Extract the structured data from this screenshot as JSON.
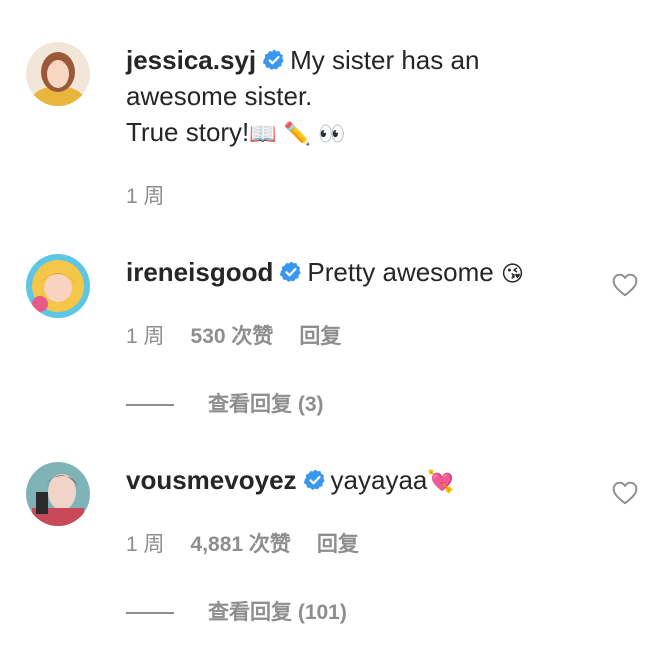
{
  "comments": [
    {
      "username": "jessica.syj",
      "verified": true,
      "text_line1": "My sister has an",
      "text_line2": "awesome sister.",
      "text_line3": "True story!",
      "emojis": "📖 ✏️ 👀",
      "time": "1 周"
    },
    {
      "username": "ireneisgood",
      "verified": true,
      "text": "Pretty awesome",
      "emoji": "😘",
      "time": "1 周",
      "likes": "530 次赞",
      "reply": "回复",
      "view_replies": "查看回复 (3)"
    },
    {
      "username": "vousmevoyez",
      "verified": true,
      "text": "yayayaa",
      "emoji": "💘",
      "time": "1 周",
      "likes": "4,881 次赞",
      "reply": "回复",
      "view_replies": "查看回复 (101)"
    }
  ],
  "colors": {
    "primary_text": "#262626",
    "secondary_text": "#8e8e8e",
    "verified_badge": "#3897f0"
  },
  "icons": {
    "verified": "verified-badge-icon",
    "like": "heart-outline-icon"
  }
}
